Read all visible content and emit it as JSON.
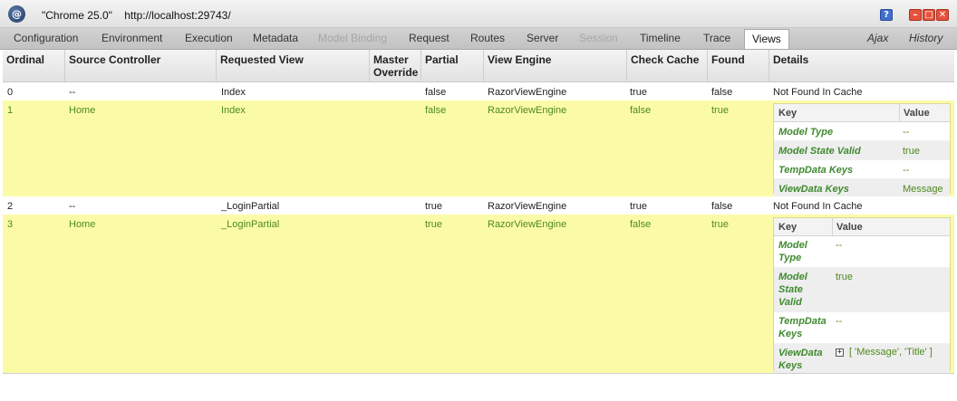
{
  "window": {
    "browser": "\"Chrome 25.0\"",
    "url": "http://localhost:29743/",
    "logo_glyph": "@",
    "help_glyph": "?",
    "min_glyph": "–",
    "max_glyph": "□",
    "close_glyph": "✕"
  },
  "tabs": [
    {
      "label": "Configuration",
      "state": "normal"
    },
    {
      "label": "Environment",
      "state": "normal"
    },
    {
      "label": "Execution",
      "state": "normal"
    },
    {
      "label": "Metadata",
      "state": "normal"
    },
    {
      "label": "Model Binding",
      "state": "disabled"
    },
    {
      "label": "Request",
      "state": "normal"
    },
    {
      "label": "Routes",
      "state": "normal"
    },
    {
      "label": "Server",
      "state": "normal"
    },
    {
      "label": "Session",
      "state": "disabled"
    },
    {
      "label": "Timeline",
      "state": "normal"
    },
    {
      "label": "Trace",
      "state": "normal"
    },
    {
      "label": "Views",
      "state": "active"
    },
    {
      "label": "Ajax",
      "state": "italic"
    },
    {
      "label": "History",
      "state": "italic"
    }
  ],
  "columns": [
    "Ordinal",
    "Source Controller",
    "Requested View",
    "Master Override",
    "Partial",
    "View Engine",
    "Check Cache",
    "Found",
    "Details"
  ],
  "rows": [
    {
      "ordinal": "0",
      "controller": "--",
      "view": "Index",
      "master": "",
      "partial": "false",
      "engine": "RazorViewEngine",
      "cache": "true",
      "found": "false",
      "details": "Not Found In Cache"
    },
    {
      "ordinal": "1",
      "controller": "Home",
      "view": "Index",
      "master": "",
      "partial": "false",
      "engine": "RazorViewEngine",
      "cache": "false",
      "found": "true",
      "nested": {
        "key_header": "Key",
        "value_header": "Value",
        "items": [
          {
            "key": "Model Type",
            "value": "--"
          },
          {
            "key": "Model State Valid",
            "value": "true"
          },
          {
            "key": "TempData Keys",
            "value": "--"
          },
          {
            "key": "ViewData Keys",
            "value": "Message"
          }
        ]
      }
    },
    {
      "ordinal": "2",
      "controller": "--",
      "view": "_LoginPartial",
      "master": "",
      "partial": "true",
      "engine": "RazorViewEngine",
      "cache": "true",
      "found": "false",
      "details": "Not Found In Cache"
    },
    {
      "ordinal": "3",
      "controller": "Home",
      "view": "_LoginPartial",
      "master": "",
      "partial": "true",
      "engine": "RazorViewEngine",
      "cache": "false",
      "found": "true",
      "nested": {
        "key_header": "Key",
        "value_header": "Value",
        "items": [
          {
            "key": "Model Type",
            "value": "--"
          },
          {
            "key": "Model State Valid",
            "value": "true"
          },
          {
            "key": "TempData Keys",
            "value": "--"
          },
          {
            "key": "ViewData Keys",
            "value": "[ 'Message', 'Title' ]",
            "expand_glyph": "+"
          }
        ]
      }
    }
  ],
  "colors": {
    "highlight": "#fbfba7",
    "highlight_text": "#4f8a1f",
    "key_text": "#3f8a2f"
  }
}
